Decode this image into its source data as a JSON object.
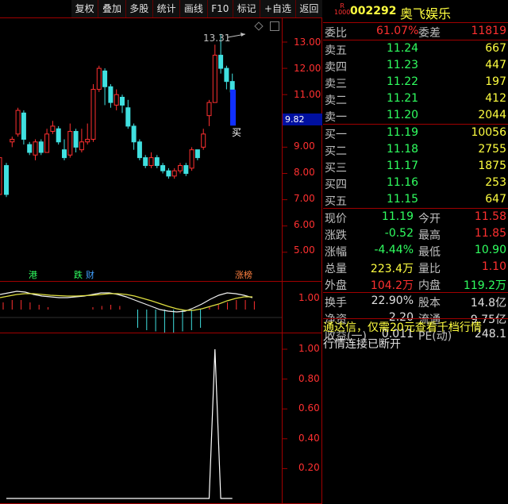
{
  "toolbar": [
    "复权",
    "叠加",
    "多股",
    "统计",
    "画线",
    "F10",
    "标记",
    "+自选",
    "返回"
  ],
  "colors": {
    "up": "#ff3030",
    "down": "#40e0e0",
    "buy_bar": "#1030ff",
    "ma_white": "#f0f0f0",
    "ma_yellow": "#e0e040",
    "frame": "#a00000"
  },
  "main_chart": {
    "yticks": [
      "13.00",
      "12.00",
      "11.00",
      "10.00",
      "9.00",
      "8.00",
      "7.00",
      "6.00",
      "5.00"
    ],
    "current_price_label": "9.82",
    "high_annotation": "13.31",
    "buy_label": "买",
    "signals": [
      {
        "text": "港",
        "color": "#30ff60"
      },
      {
        "text": "跌",
        "color": "#30ff60"
      },
      {
        "text": "财",
        "color": "#40a0ff"
      },
      {
        "text": "涨榜",
        "color": "#ff8040"
      }
    ]
  },
  "indicator1": {
    "yticks": [
      "1.00"
    ]
  },
  "indicator2": {
    "yticks": [
      "1.00",
      "0.80",
      "0.60",
      "0.40",
      "0.20"
    ]
  },
  "chart_data": {
    "type": "candlestick",
    "ylim": [
      4.4,
      14.0
    ],
    "candles": [
      [
        8.3,
        7.2,
        8.4,
        7.1
      ],
      [
        9.2,
        9.3,
        9.4,
        9.0
      ],
      [
        9.5,
        10.4,
        10.5,
        9.4
      ],
      [
        10.3,
        9.3,
        10.4,
        9.1
      ],
      [
        9.1,
        8.8,
        9.2,
        8.7
      ],
      [
        8.7,
        9.2,
        9.3,
        8.5
      ],
      [
        9.2,
        8.8,
        9.3,
        8.7
      ],
      [
        8.8,
        9.5,
        9.7,
        8.8
      ],
      [
        9.6,
        9.8,
        10.0,
        9.5
      ],
      [
        9.7,
        9.2,
        9.8,
        9.1
      ],
      [
        8.9,
        8.6,
        9.3,
        8.5
      ],
      [
        8.7,
        9.6,
        9.9,
        8.6
      ],
      [
        9.6,
        9.0,
        9.7,
        8.8
      ],
      [
        8.9,
        9.2,
        9.7,
        8.8
      ],
      [
        9.2,
        9.3,
        9.9,
        9.1
      ],
      [
        9.3,
        11.2,
        11.4,
        9.2
      ],
      [
        11.2,
        12.0,
        12.1,
        11.1
      ],
      [
        11.9,
        11.3,
        12.0,
        10.6
      ],
      [
        11.3,
        10.7,
        11.4,
        10.5
      ],
      [
        10.6,
        11.0,
        11.2,
        10.4
      ],
      [
        10.9,
        10.6,
        11.0,
        10.3
      ],
      [
        10.5,
        9.8,
        10.8,
        9.7
      ],
      [
        9.8,
        9.2,
        9.9,
        8.9
      ],
      [
        9.2,
        8.6,
        9.3,
        8.5
      ],
      [
        8.6,
        8.3,
        8.7,
        8.2
      ],
      [
        8.3,
        8.6,
        8.8,
        8.2
      ],
      [
        8.6,
        8.3,
        8.7,
        8.2
      ],
      [
        8.3,
        8.1,
        8.4,
        8.0
      ],
      [
        8.1,
        7.9,
        8.2,
        7.8
      ],
      [
        7.9,
        8.1,
        8.2,
        7.8
      ],
      [
        8.1,
        8.3,
        8.4,
        8.0
      ],
      [
        8.3,
        8.0,
        8.4,
        7.9
      ],
      [
        8.2,
        8.9,
        9.0,
        8.1
      ],
      [
        8.9,
        8.6,
        8.9,
        8.5
      ],
      [
        9.0,
        9.5,
        9.7,
        8.9
      ],
      [
        10.2,
        10.7,
        10.8,
        9.8
      ],
      [
        10.7,
        12.5,
        12.9,
        10.7
      ],
      [
        12.5,
        12.0,
        13.31,
        11.8
      ],
      [
        12.0,
        11.5,
        12.1,
        11.2
      ],
      [
        11.5,
        11.1,
        11.8,
        10.9
      ]
    ],
    "buy_candle": [
      9.82,
      11.19,
      11.19,
      9.82
    ],
    "macd_white": [
      0.58,
      0.62,
      0.66,
      0.64,
      0.58,
      0.54,
      0.52,
      0.5,
      0.5,
      0.52,
      0.54,
      0.58,
      0.62,
      0.62,
      0.58,
      0.52,
      0.44,
      0.36,
      0.28,
      0.2,
      0.16,
      0.14,
      0.16,
      0.24,
      0.34,
      0.46,
      0.56,
      0.62,
      0.6,
      0.56,
      0.5
    ],
    "macd_yellow": [
      0.5,
      0.54,
      0.58,
      0.6,
      0.6,
      0.58,
      0.56,
      0.55,
      0.54,
      0.54,
      0.55,
      0.56,
      0.58,
      0.6,
      0.6,
      0.58,
      0.54,
      0.48,
      0.42,
      0.35,
      0.28,
      0.22,
      0.18,
      0.18,
      0.22,
      0.28,
      0.34,
      0.42,
      0.48,
      0.52,
      0.52
    ],
    "macd_hist": [
      0.3,
      0.4,
      0.4,
      0.3,
      0.2,
      0.1,
      0,
      0,
      0,
      0,
      0.1,
      0.15,
      0.2,
      0.15,
      0,
      -0.1,
      -0.2,
      -0.25,
      -0.3,
      -0.3,
      -0.25,
      -0.2,
      -0.1,
      0.1,
      0.2,
      0.3,
      0.4,
      0.4,
      0.35
    ],
    "signal_line": [
      0,
      0,
      0,
      0,
      0,
      0,
      0,
      0,
      0,
      0,
      0,
      0,
      0,
      0,
      0,
      0,
      0,
      0,
      0,
      0,
      0,
      0,
      0,
      0,
      0,
      0,
      0,
      0,
      0,
      0,
      0,
      0,
      0,
      0,
      0,
      0,
      1,
      0,
      0,
      0
    ]
  },
  "panel": {
    "title": {
      "logo_top": "R",
      "logo_bottom": "1000",
      "code": "002292",
      "name": "奥飞娱乐"
    },
    "weibi": {
      "label": "委比",
      "value": "61.07%",
      "label2": "委差",
      "value2": "11819"
    },
    "sells": [
      {
        "label": "卖五",
        "price": "11.24",
        "vol": "667"
      },
      {
        "label": "卖四",
        "price": "11.23",
        "vol": "447"
      },
      {
        "label": "卖三",
        "price": "11.22",
        "vol": "197"
      },
      {
        "label": "卖二",
        "price": "11.21",
        "vol": "412"
      },
      {
        "label": "卖一",
        "price": "11.20",
        "vol": "2044"
      }
    ],
    "buys": [
      {
        "label": "买一",
        "price": "11.19",
        "vol": "10056"
      },
      {
        "label": "买二",
        "price": "11.18",
        "vol": "2755"
      },
      {
        "label": "买三",
        "price": "11.17",
        "vol": "1875"
      },
      {
        "label": "买四",
        "price": "11.16",
        "vol": "253"
      },
      {
        "label": "买五",
        "price": "11.15",
        "vol": "647"
      }
    ],
    "quote": [
      {
        "l1": "现价",
        "v1": "11.19",
        "l2": "今开",
        "v2": "11.58"
      },
      {
        "l1": "涨跌",
        "v1": "-0.52",
        "l2": "最高",
        "v2": "11.85"
      },
      {
        "l1": "涨幅",
        "v1": "-4.44%",
        "l2": "最低",
        "v2": "10.90"
      },
      {
        "l1": "总量",
        "v1": "223.4万",
        "l2": "量比",
        "v2": "1.10"
      },
      {
        "l1": "外盘",
        "v1": "104.2万",
        "l2": "内盘",
        "v2": "119.2万"
      }
    ],
    "stats": [
      {
        "l1": "换手",
        "v1": "22.90%",
        "l2": "股本",
        "v2": "14.8亿"
      },
      {
        "l1": "净资",
        "v1": "2.20",
        "l2": "流通",
        "v2": "9.75亿"
      },
      {
        "l1": "收益(一)",
        "v1": "0.011",
        "l2": "PE(动)",
        "v2": "248.1"
      }
    ],
    "msg1": "通达信，仅需20元查看千档行情",
    "msg2": "行情连接已断开"
  }
}
